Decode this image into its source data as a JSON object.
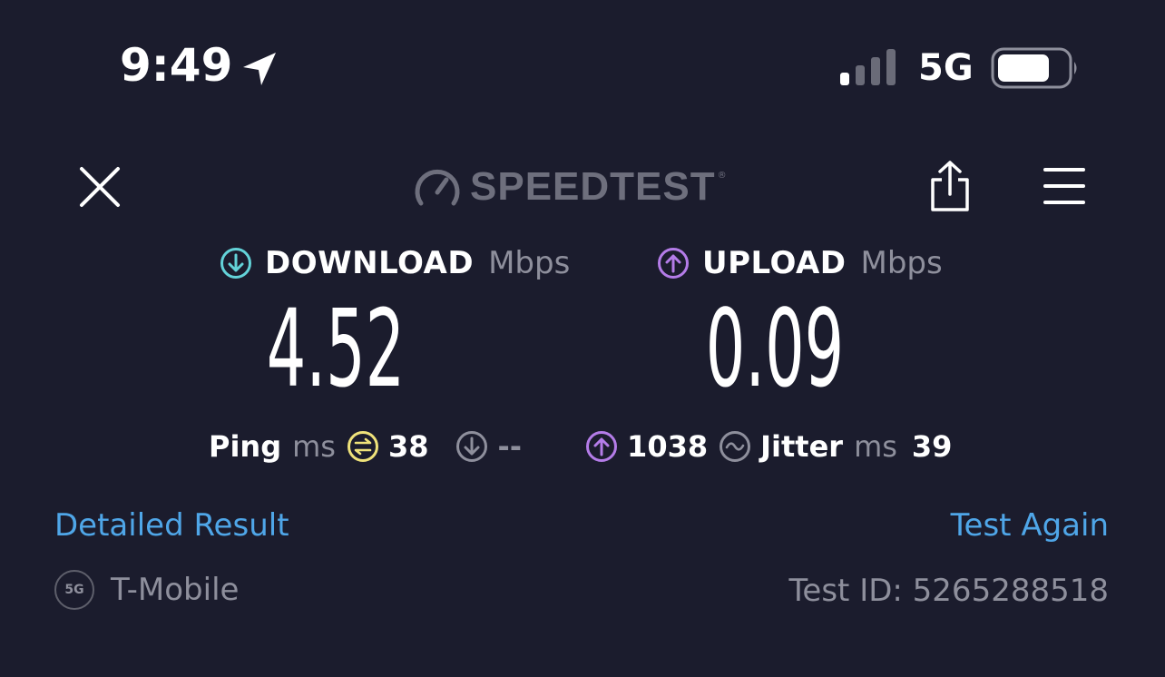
{
  "status_bar": {
    "time": "9:49",
    "network": "5G",
    "location_icon": "location-arrow-icon",
    "signal_icon": "cellular-signal-icon",
    "battery_icon": "battery-icon"
  },
  "header": {
    "logo_text": "SPEEDTEST",
    "logo_mark": "®",
    "close_icon": "close-icon",
    "share_icon": "share-icon",
    "menu_icon": "hamburger-menu-icon"
  },
  "download": {
    "label": "DOWNLOAD",
    "unit": "Mbps",
    "value": "4.52",
    "color": "#63d2d8"
  },
  "upload": {
    "label": "UPLOAD",
    "unit": "Mbps",
    "value": "0.09",
    "color": "#b47ce8"
  },
  "ping": {
    "label": "Ping",
    "unit": "ms",
    "idle_value": "38",
    "download_value": "--",
    "upload_value": "1038",
    "idle_color": "#efe27a"
  },
  "jitter": {
    "label": "Jitter",
    "unit": "ms",
    "value": "39"
  },
  "links": {
    "detailed": "Detailed Result",
    "test_again": "Test Again"
  },
  "footer": {
    "carrier_badge": "5G",
    "carrier_name": "T-Mobile",
    "test_id": "Test ID: 5265288518"
  }
}
